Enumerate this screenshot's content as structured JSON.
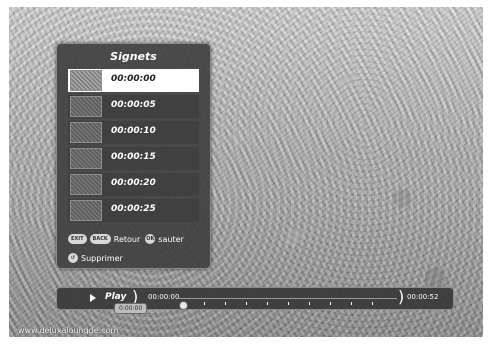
{
  "bookmarks_panel": {
    "title": "Signets",
    "items": [
      {
        "time": "00:00:00",
        "selected": true
      },
      {
        "time": "00:00:05",
        "selected": false
      },
      {
        "time": "00:00:10",
        "selected": false
      },
      {
        "time": "00:00:15",
        "selected": false
      },
      {
        "time": "00:00:20",
        "selected": false
      },
      {
        "time": "00:00:25",
        "selected": false
      }
    ],
    "legend": {
      "exit_key": "EXIT",
      "back_key": "BACK",
      "back_label": "Retour",
      "ok_key": "OK",
      "ok_label": "sauter",
      "delete_label": "Supprimer"
    }
  },
  "playback": {
    "state_label": "Play",
    "start_time": "00:00:00",
    "end_time": "00:00:52",
    "position_label": "0:00:00",
    "position_fraction": 0.0
  },
  "watermark": "www.deluxaloungde.com"
}
